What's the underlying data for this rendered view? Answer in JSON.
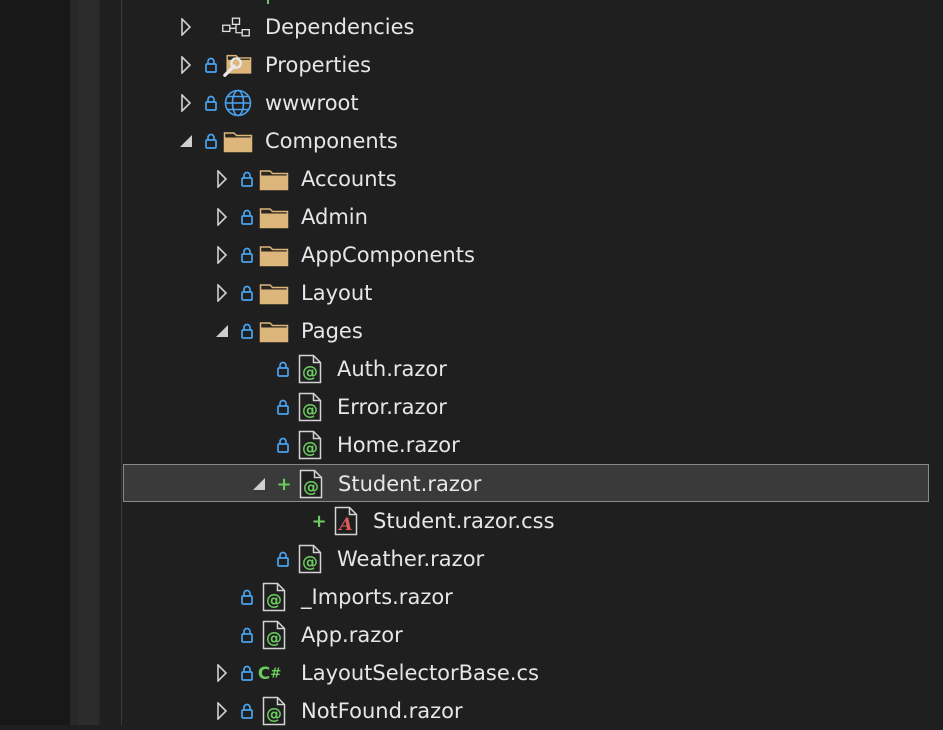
{
  "colors": {
    "background": "#1f1f1f",
    "selection": "#3a3a3a",
    "lock": "#4aa3f0",
    "folder": "#dcb67a",
    "razor": "#6ccb5f",
    "csharp": "#6ccb5f",
    "css": "#e05a5a"
  },
  "tree": [
    {
      "label": "Dependencies",
      "level": 0,
      "expander": "collapsed",
      "lock": false,
      "icon": "dependencies-icon"
    },
    {
      "label": "Properties",
      "level": 0,
      "expander": "collapsed",
      "lock": true,
      "icon": "properties-folder-icon"
    },
    {
      "label": "wwwroot",
      "level": 0,
      "expander": "collapsed",
      "lock": true,
      "icon": "globe-icon"
    },
    {
      "label": "Components",
      "level": 0,
      "expander": "expanded",
      "lock": true,
      "icon": "folder-icon"
    },
    {
      "label": "Accounts",
      "level": 1,
      "expander": "collapsed",
      "lock": true,
      "icon": "folder-icon"
    },
    {
      "label": "Admin",
      "level": 1,
      "expander": "collapsed",
      "lock": true,
      "icon": "folder-icon"
    },
    {
      "label": "AppComponents",
      "level": 1,
      "expander": "collapsed",
      "lock": true,
      "icon": "folder-icon"
    },
    {
      "label": "Layout",
      "level": 1,
      "expander": "collapsed",
      "lock": true,
      "icon": "folder-icon"
    },
    {
      "label": "Pages",
      "level": 1,
      "expander": "expanded",
      "lock": true,
      "icon": "folder-icon"
    },
    {
      "label": "Auth.razor",
      "level": 2,
      "expander": "none",
      "lock": true,
      "icon": "razor-file-icon"
    },
    {
      "label": "Error.razor",
      "level": 2,
      "expander": "none",
      "lock": true,
      "icon": "razor-file-icon"
    },
    {
      "label": "Home.razor",
      "level": 2,
      "expander": "none",
      "lock": true,
      "icon": "razor-file-icon"
    },
    {
      "label": "Student.razor",
      "level": 2,
      "expander": "expanded",
      "lock": false,
      "added": true,
      "selected": true,
      "icon": "razor-file-icon"
    },
    {
      "label": "Student.razor.css",
      "level": 3,
      "expander": "none",
      "lock": false,
      "added": true,
      "icon": "css-file-icon"
    },
    {
      "label": "Weather.razor",
      "level": 2,
      "expander": "none",
      "lock": true,
      "icon": "razor-file-icon"
    },
    {
      "label": "_Imports.razor",
      "level": 1,
      "expander": "none",
      "lock": true,
      "icon": "razor-file-icon"
    },
    {
      "label": "App.razor",
      "level": 1,
      "expander": "none",
      "lock": true,
      "icon": "razor-file-icon"
    },
    {
      "label": "LayoutSelectorBase.cs",
      "level": 1,
      "expander": "collapsed",
      "lock": true,
      "icon": "csharp-file-icon"
    },
    {
      "label": "NotFound.razor",
      "level": 1,
      "expander": "collapsed",
      "lock": true,
      "icon": "razor-file-icon"
    }
  ]
}
